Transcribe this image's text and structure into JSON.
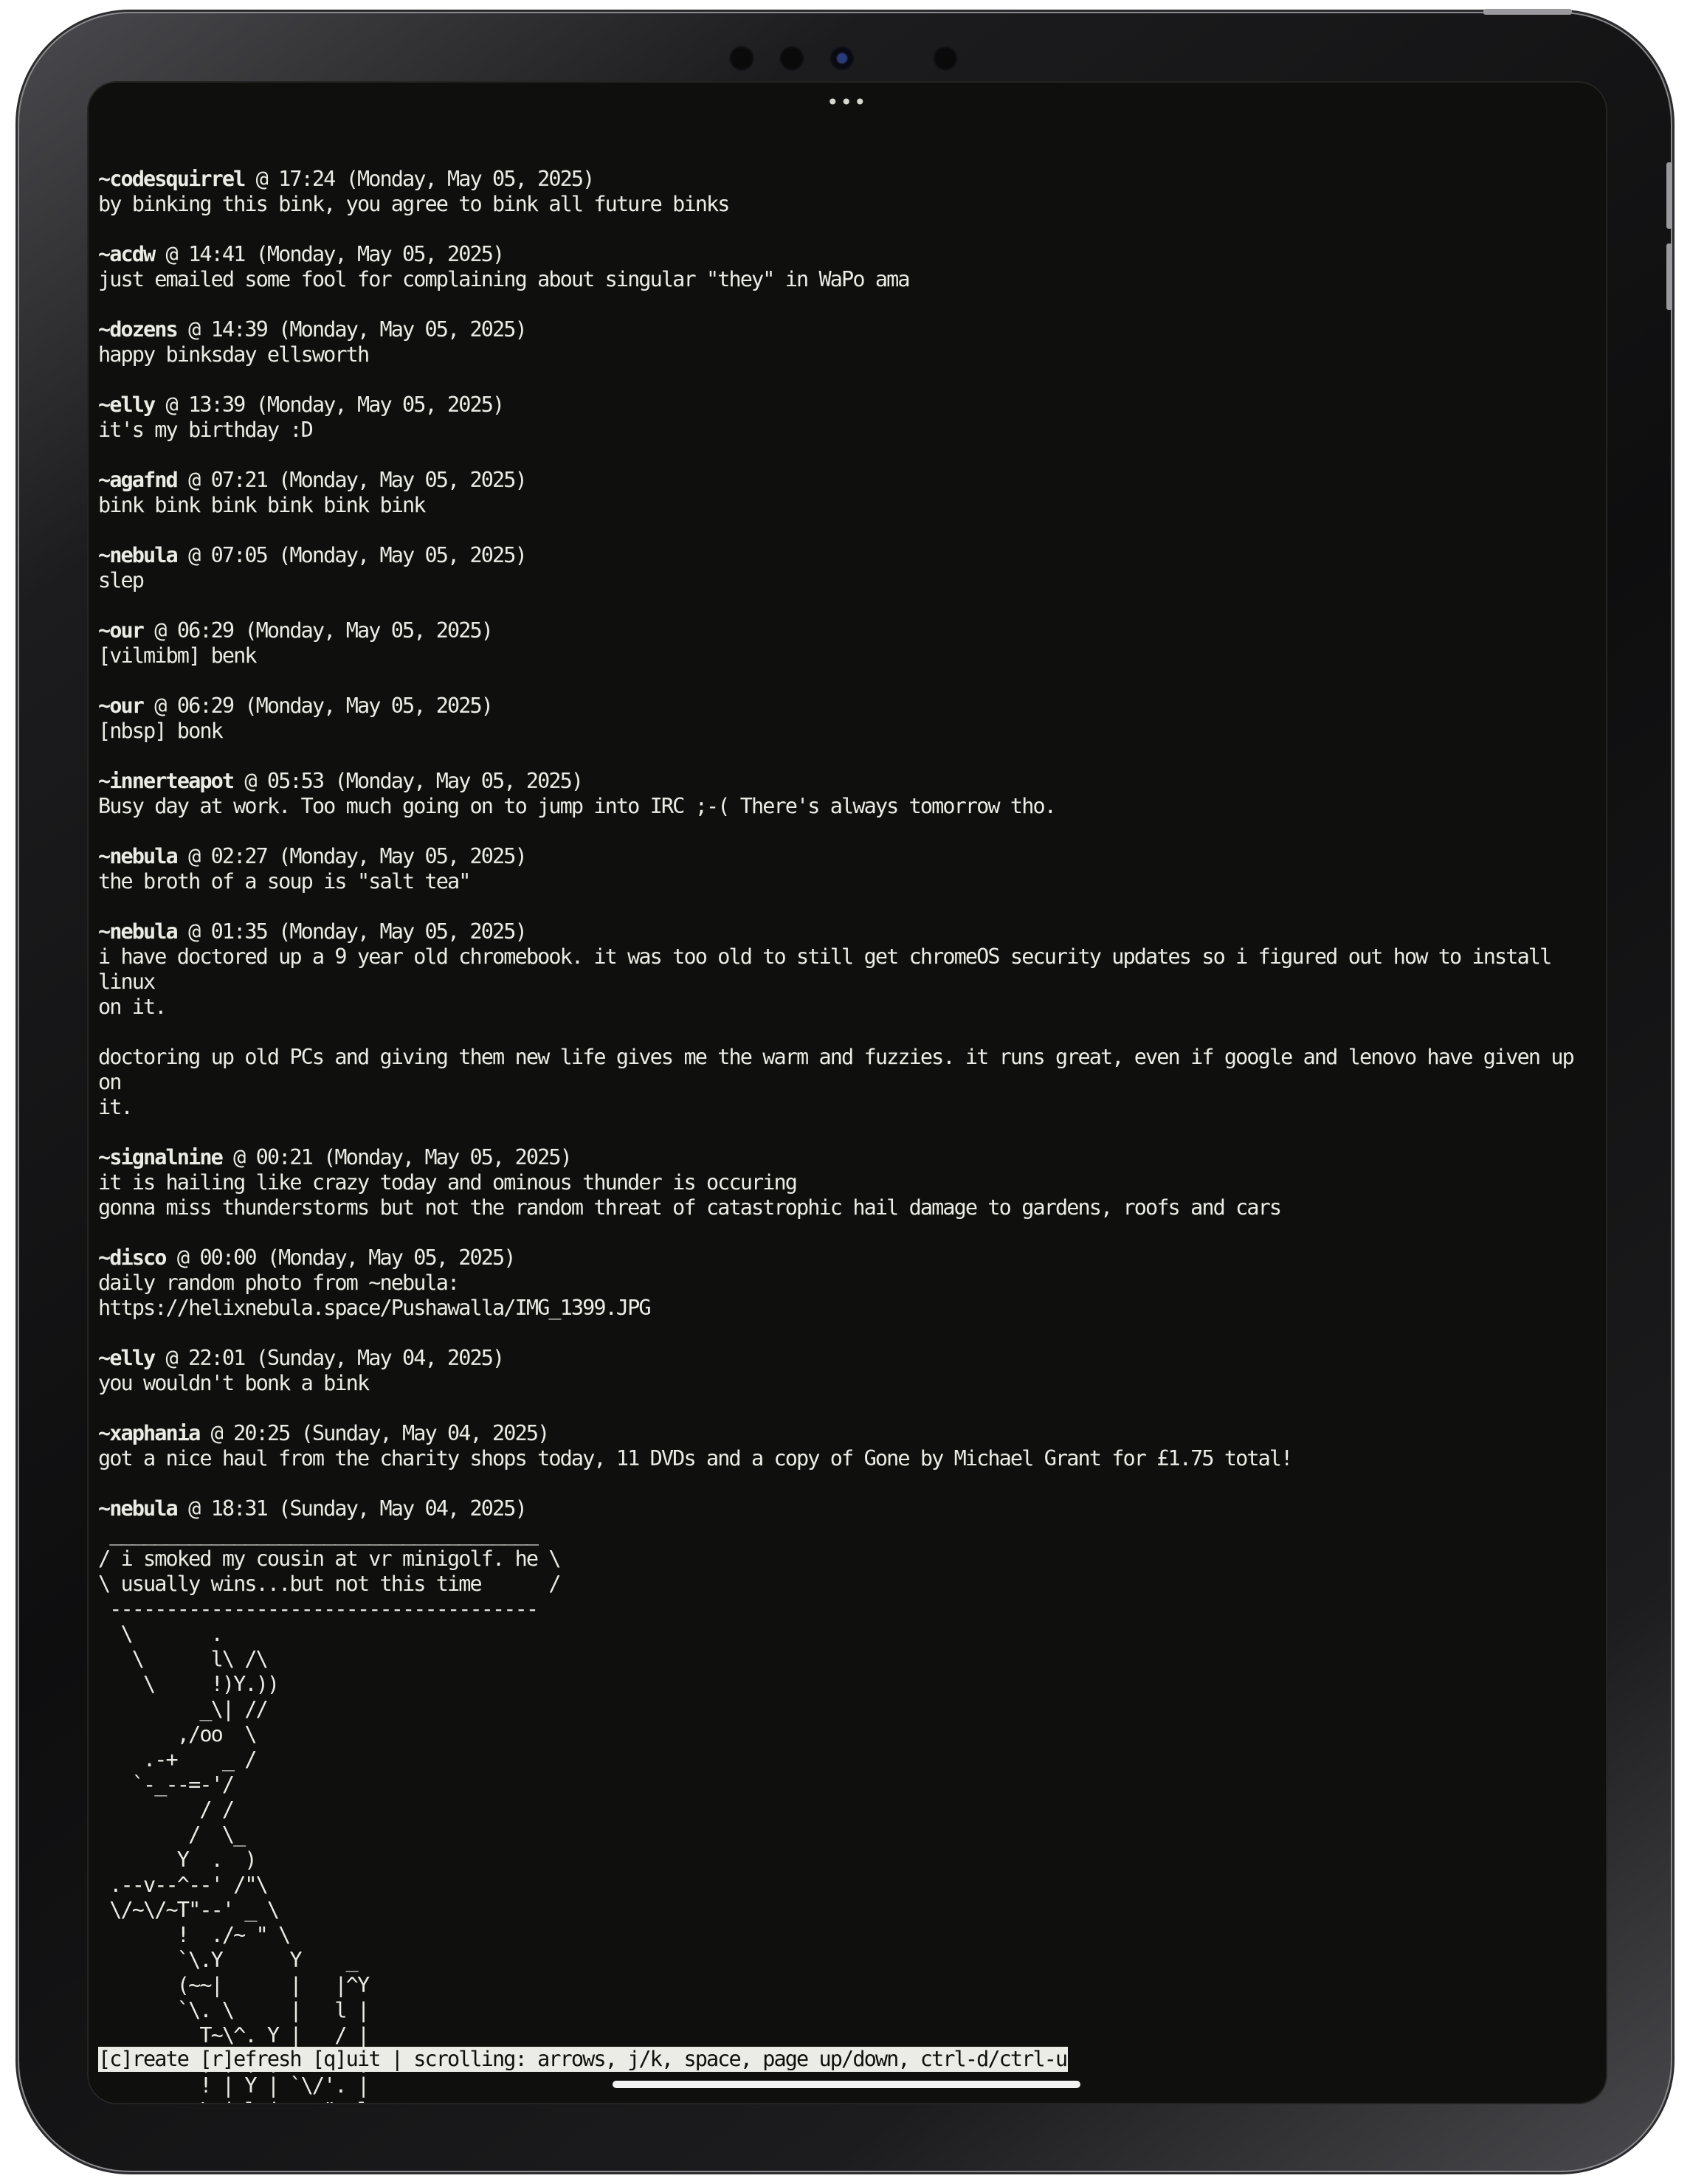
{
  "posts": [
    {
      "user": "~codesquirrel",
      "meta": " @ 17:24 (Monday, May 05, 2025)",
      "lines": [
        "by binking this bink, you agree to bink all future binks"
      ]
    },
    {
      "user": "~acdw",
      "meta": " @ 14:41 (Monday, May 05, 2025)",
      "lines": [
        "just emailed some fool for complaining about singular \"they\" in WaPo ama"
      ]
    },
    {
      "user": "~dozens",
      "meta": " @ 14:39 (Monday, May 05, 2025)",
      "lines": [
        "happy binksday ellsworth"
      ]
    },
    {
      "user": "~elly",
      "meta": " @ 13:39 (Monday, May 05, 2025)",
      "lines": [
        "it's my birthday :D"
      ]
    },
    {
      "user": "~agafnd",
      "meta": " @ 07:21 (Monday, May 05, 2025)",
      "lines": [
        "bink bink bink bink bink bink"
      ]
    },
    {
      "user": "~nebula",
      "meta": " @ 07:05 (Monday, May 05, 2025)",
      "lines": [
        "slep"
      ]
    },
    {
      "user": "~our",
      "meta": " @ 06:29 (Monday, May 05, 2025)",
      "lines": [
        "[vilmibm] benk"
      ]
    },
    {
      "user": "~our",
      "meta": " @ 06:29 (Monday, May 05, 2025)",
      "lines": [
        "[nbsp] bonk"
      ]
    },
    {
      "user": "~innerteapot",
      "meta": " @ 05:53 (Monday, May 05, 2025)",
      "lines": [
        "Busy day at work. Too much going on to jump into IRC ;-( There's always tomorrow tho."
      ]
    },
    {
      "user": "~nebula",
      "meta": " @ 02:27 (Monday, May 05, 2025)",
      "lines": [
        "the broth of a soup is \"salt tea\""
      ]
    },
    {
      "user": "~nebula",
      "meta": " @ 01:35 (Monday, May 05, 2025)",
      "lines": [
        "i have doctored up a 9 year old chromebook. it was too old to still get chromeOS security updates so i figured out how to install linux\non it.\n\ndoctoring up old PCs and giving them new life gives me the warm and fuzzies. it runs great, even if google and lenovo have given up on\nit."
      ]
    },
    {
      "user": "~signalnine",
      "meta": " @ 00:21 (Monday, May 05, 2025)",
      "lines": [
        "it is hailing like crazy today and ominous thunder is occuring",
        "gonna miss thunderstorms but not the random threat of catastrophic hail damage to gardens, roofs and cars"
      ]
    },
    {
      "user": "~disco",
      "meta": " @ 00:00 (Monday, May 05, 2025)",
      "lines": [
        "daily random photo from ~nebula:",
        "https://helixnebula.space/Pushawalla/IMG_1399.JPG"
      ]
    },
    {
      "user": "~elly",
      "meta": " @ 22:01 (Sunday, May 04, 2025)",
      "lines": [
        "you wouldn't bonk a bink"
      ]
    },
    {
      "user": "~xaphania",
      "meta": " @ 20:25 (Sunday, May 04, 2025)",
      "lines": [
        "got a nice haul from the charity shops today, 11 DVDs and a copy of Gone by Michael Grant for £1.75 total!"
      ]
    }
  ],
  "last_post": {
    "user": "~nebula",
    "meta": " @ 18:31 (Sunday, May 04, 2025)",
    "ascii": " ______________________________________\n/ i smoked my cousin at vr minigolf. he \\\n\\ usually wins...but not this time      /\n --------------------------------------\n  \\       .\n   \\      l\\ /\\\n    \\     !)Y.))\n         _\\| //\n       ,/oo  \\\n    .-+    _ /\n   `-_--=-'/\n         / /\n        /  \\_\n       Y  .  )\n .--v--^--' /\"\\\n \\/~\\/~T\"--' _ \\\n       !  ./~ \" \\\n       `\\.Y      Y    _\n       (~~|      |   |^Y\n       `\\. \\     |   l |\n         T~\\^. Y |   / |\n         | |\\| | !  l  |\n         ! | Y | `\\/'. |\n   ______L_j l j   ~\"  l\n _/,_/, __ ~\"__ }____,/\n~~~~~~~~~~~~~~~~~~~~~~~~~~~"
  },
  "status_bar": "[c]reate [r]efresh [q]uit | scrolling: arrows, j/k, space, page up/down, ctrl-d/ctrl-u",
  "top_indicator": "•••"
}
